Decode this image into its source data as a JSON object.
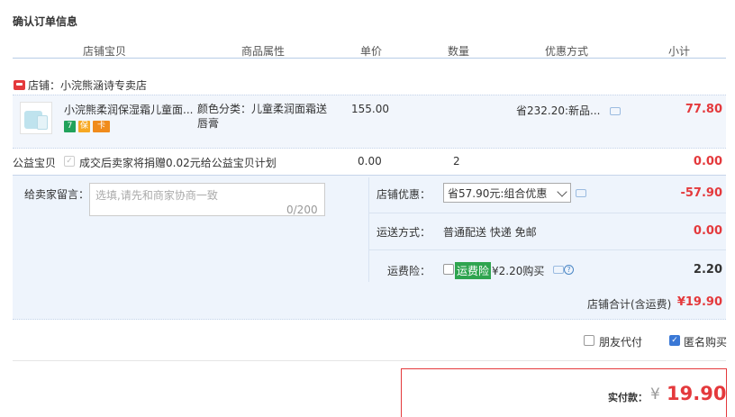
{
  "title": "确认订单信息",
  "columns": [
    "店铺宝贝",
    "商品属性",
    "单价",
    "数量",
    "优惠方式",
    "小计"
  ],
  "shop": {
    "label": "店铺：小浣熊涵诗专卖店"
  },
  "item": {
    "title": "小浣熊柔润保湿霜儿童面...",
    "tags": [
      "7",
      "保",
      "卡"
    ],
    "attr": "颜色分类：儿童柔润面霜送唇膏",
    "price": "155.00",
    "promo": "省232.20:新品...",
    "subtotal": "77.80"
  },
  "charity": {
    "label": "公益宝贝",
    "text": "成交后卖家将捐赠0.02元给公益宝贝计划",
    "price": "0.00",
    "qty": "2",
    "subtotal": "0.00"
  },
  "message": {
    "label": "给卖家留言：",
    "placeholder": "选填,请先和商家协商一致",
    "count": "0/200"
  },
  "store_discount": {
    "label": "店铺优惠：",
    "selected": "省57.90元:组合优惠",
    "value": "-57.90"
  },
  "shipping": {
    "label": "运送方式：",
    "value_text": "普通配送 快递 免邮",
    "value": "0.00"
  },
  "insurance": {
    "label": "运费险：",
    "badge": "运费险",
    "text": "¥2.20购买",
    "value": "2.20"
  },
  "store_total": {
    "label": "店铺合计(含运费)",
    "value": "¥19.90"
  },
  "options": {
    "friend_pay": "朋友代付",
    "anonymous": "匿名购买"
  },
  "payment": {
    "label": "实付款：",
    "yen": "¥",
    "amount": "19.90"
  },
  "colors": {
    "accent": "#e4393c",
    "panel_bg": "#eef4fc",
    "insurance_green": "#2ea44f",
    "checkbox_blue": "#3a78d6"
  }
}
